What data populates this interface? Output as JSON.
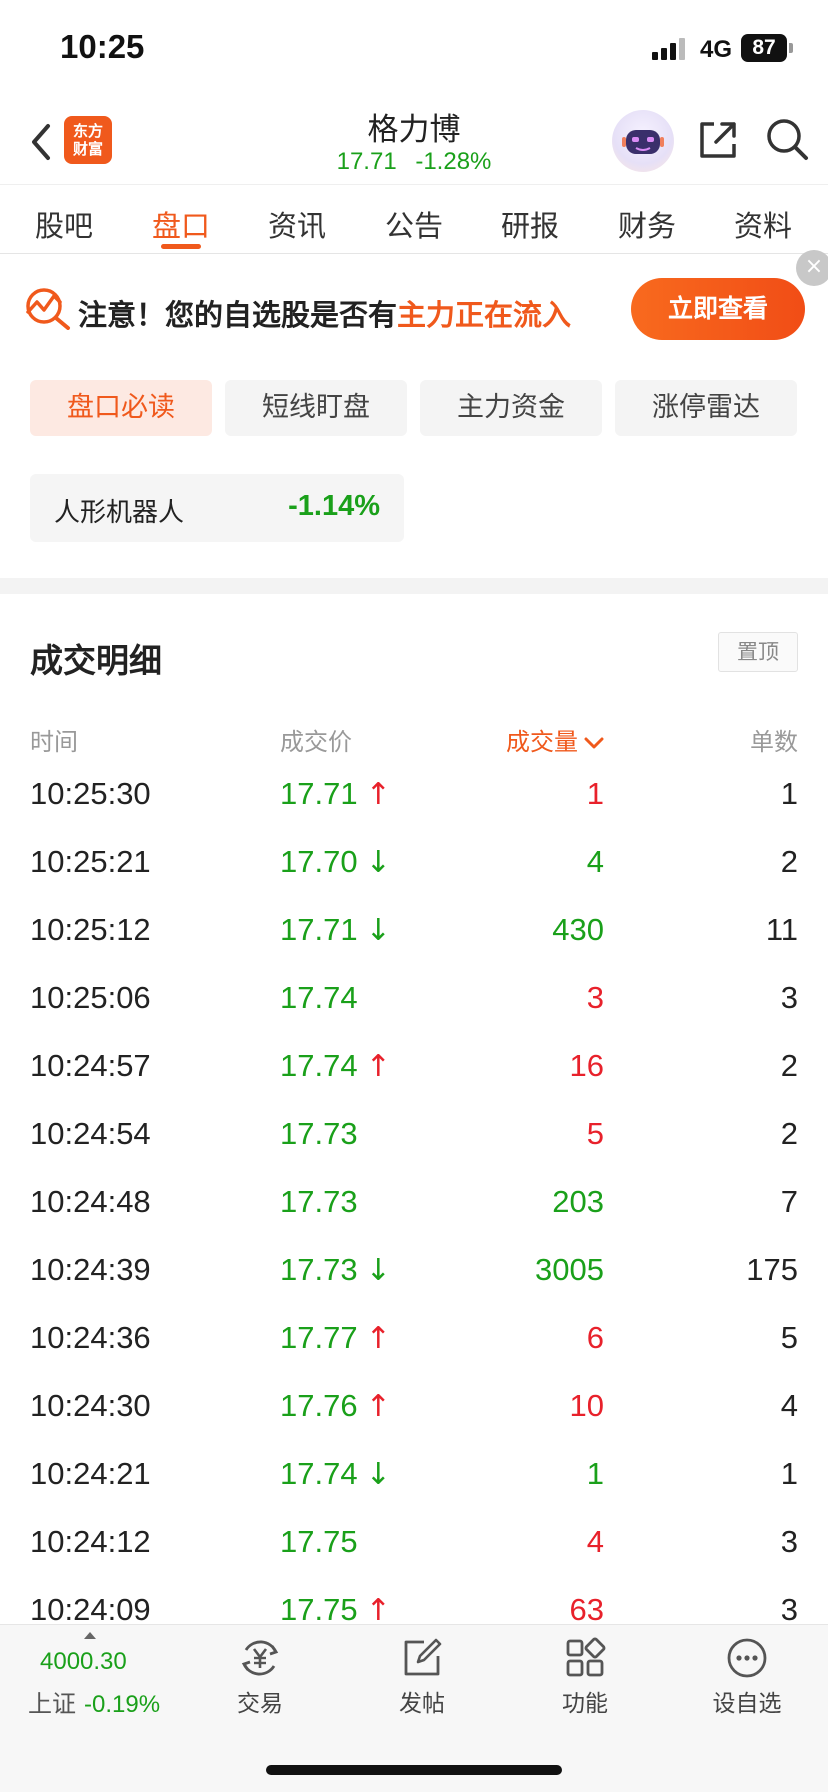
{
  "status_bar": {
    "time": "10:25",
    "network": "4G",
    "battery": "87"
  },
  "header": {
    "logo_line1": "东方",
    "logo_line2": "财富",
    "stock_name": "格力博",
    "price": "17.71",
    "change_pct": "-1.28%"
  },
  "tabs": [
    {
      "label": "股吧"
    },
    {
      "label": "盘口",
      "active": true
    },
    {
      "label": "资讯"
    },
    {
      "label": "公告"
    },
    {
      "label": "研报"
    },
    {
      "label": "财务"
    },
    {
      "label": "资料"
    }
  ],
  "banner": {
    "text_prefix": "注意！您的自选股是否有",
    "text_highlight": "主力正在流入",
    "button": "立即查看",
    "close": "×"
  },
  "sub_tabs": [
    {
      "label": "盘口必读",
      "active": true
    },
    {
      "label": "短线盯盘"
    },
    {
      "label": "主力资金"
    },
    {
      "label": "涨停雷达"
    }
  ],
  "sector": {
    "name": "人形机器人",
    "change": "-1.14%"
  },
  "trade_detail": {
    "title": "成交明细",
    "pin_label": "置顶",
    "columns": {
      "time": "时间",
      "price": "成交价",
      "volume": "成交量",
      "count": "单数"
    },
    "rows": [
      {
        "time": "10:25:30",
        "price": "17.71",
        "dir": "up",
        "volume": "1",
        "vol_color": "red",
        "count": "1"
      },
      {
        "time": "10:25:21",
        "price": "17.70",
        "dir": "down",
        "volume": "4",
        "vol_color": "green",
        "count": "2"
      },
      {
        "time": "10:25:12",
        "price": "17.71",
        "dir": "down",
        "volume": "430",
        "vol_color": "green",
        "count": "11"
      },
      {
        "time": "10:25:06",
        "price": "17.74",
        "dir": "",
        "volume": "3",
        "vol_color": "red",
        "count": "3"
      },
      {
        "time": "10:24:57",
        "price": "17.74",
        "dir": "up",
        "volume": "16",
        "vol_color": "red",
        "count": "2"
      },
      {
        "time": "10:24:54",
        "price": "17.73",
        "dir": "",
        "volume": "5",
        "vol_color": "red",
        "count": "2"
      },
      {
        "time": "10:24:48",
        "price": "17.73",
        "dir": "",
        "volume": "203",
        "vol_color": "green",
        "count": "7"
      },
      {
        "time": "10:24:39",
        "price": "17.73",
        "dir": "down",
        "volume": "3005",
        "vol_color": "green",
        "count": "175"
      },
      {
        "time": "10:24:36",
        "price": "17.77",
        "dir": "up",
        "volume": "6",
        "vol_color": "red",
        "count": "5"
      },
      {
        "time": "10:24:30",
        "price": "17.76",
        "dir": "up",
        "volume": "10",
        "vol_color": "red",
        "count": "4"
      },
      {
        "time": "10:24:21",
        "price": "17.74",
        "dir": "down",
        "volume": "1",
        "vol_color": "green",
        "count": "1"
      },
      {
        "time": "10:24:12",
        "price": "17.75",
        "dir": "",
        "volume": "4",
        "vol_color": "red",
        "count": "3"
      },
      {
        "time": "10:24:09",
        "price": "17.75",
        "dir": "up",
        "volume": "63",
        "vol_color": "red",
        "count": "3"
      }
    ]
  },
  "bottom_bar": {
    "index_value": "4000.30",
    "index_name": "上证",
    "index_change": "-0.19%",
    "nav": [
      {
        "label": "交易",
        "icon": "trade-yen-icon"
      },
      {
        "label": "发帖",
        "icon": "compose-icon"
      },
      {
        "label": "功能",
        "icon": "grid-icon"
      },
      {
        "label": "设自选",
        "icon": "more-dots-icon"
      }
    ]
  },
  "colors": {
    "accent": "#f0591c",
    "up": "#e8212b",
    "down": "#1aa01a"
  }
}
